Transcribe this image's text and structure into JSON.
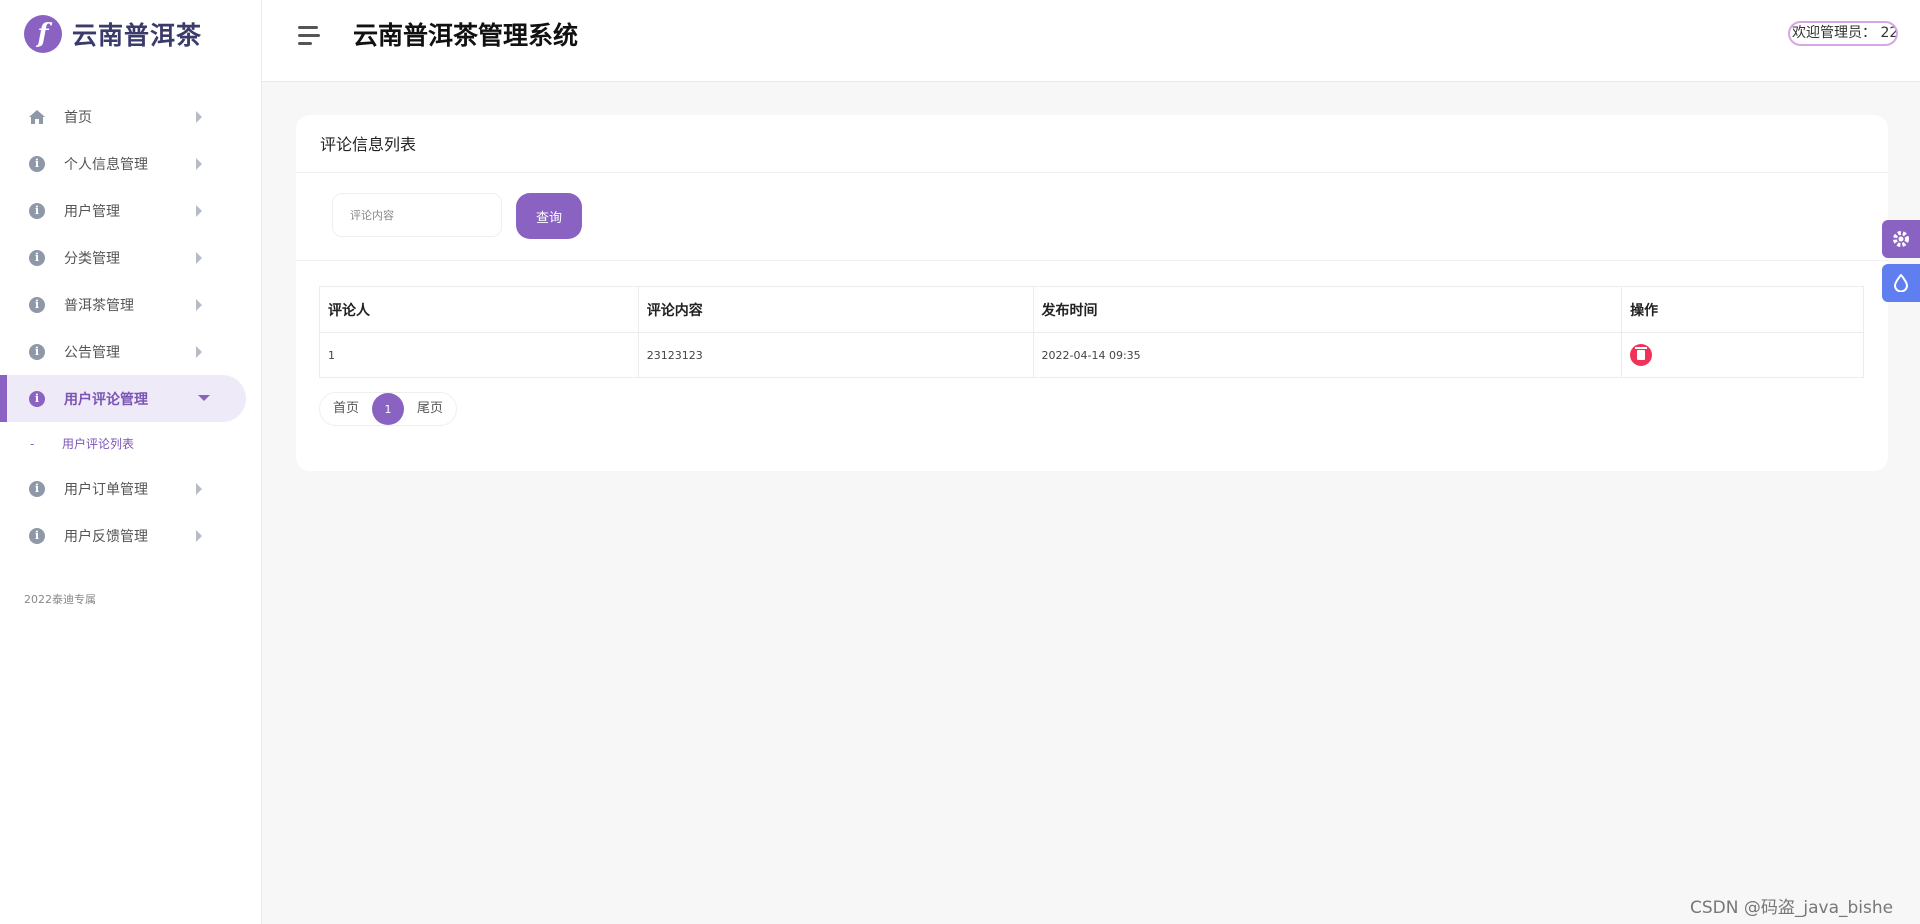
{
  "app": {
    "logo_letter": "f",
    "logo_text": "云南普洱茶",
    "system_title": "云南普洱茶管理系统",
    "welcome": "欢迎管理员： 22"
  },
  "sidebar": {
    "items": [
      {
        "label": "首页",
        "icon": "home-icon"
      },
      {
        "label": "个人信息管理",
        "icon": "info-icon"
      },
      {
        "label": "用户管理",
        "icon": "info-icon"
      },
      {
        "label": "分类管理",
        "icon": "info-icon"
      },
      {
        "label": "普洱茶管理",
        "icon": "info-icon"
      },
      {
        "label": "公告管理",
        "icon": "info-icon"
      },
      {
        "label": "用户评论管理",
        "icon": "info-icon",
        "active": true
      },
      {
        "label": "用户订单管理",
        "icon": "info-icon"
      },
      {
        "label": "用户反馈管理",
        "icon": "info-icon"
      }
    ],
    "submenu": {
      "dash": "-",
      "label": "用户评论列表"
    },
    "copyright": "2022泰迪专属"
  },
  "main": {
    "card_title": "评论信息列表",
    "search": {
      "placeholder": "评论内容",
      "button": "查询"
    },
    "table": {
      "headers": [
        "评论人",
        "评论内容",
        "发布时间",
        "操作"
      ],
      "rows": [
        {
          "commenter": "1",
          "content": "23123123",
          "time": "2022-04-14 09:35"
        }
      ]
    },
    "pagination": {
      "first": "首页",
      "current": "1",
      "last": "尾页"
    }
  },
  "floating": {
    "settings_icon": "gear-icon",
    "theme_icon": "drop-icon"
  },
  "watermark": "CSDN @码盗_java_bishe",
  "colors": {
    "accent": "#8a63c2",
    "delete": "#f0325a",
    "theme_button": "#5f7ff0"
  }
}
